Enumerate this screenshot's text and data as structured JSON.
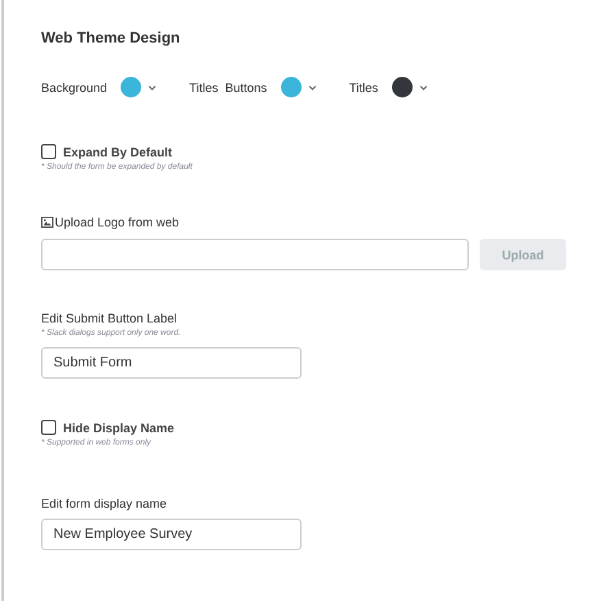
{
  "title": "Web Theme Design",
  "colors": [
    {
      "label": "Background",
      "color": "#3bb5d9"
    },
    {
      "label": "Titles  Buttons",
      "color": "#3bb5d9"
    },
    {
      "label": "Titles",
      "color": "#33363a"
    }
  ],
  "expand": {
    "label": "Expand By Default",
    "checked": false,
    "hint": "* Should the form be expanded by default"
  },
  "upload": {
    "label": "Upload Logo from web",
    "button": "Upload"
  },
  "submit_label": {
    "label": "Edit Submit Button Label",
    "hint": "* Slack dialogs support only one word.",
    "value": "Submit Form"
  },
  "hide_name": {
    "label": "Hide Display Name",
    "checked": false,
    "hint": "* Supported in web forms only"
  },
  "display_name": {
    "label": "Edit form display name",
    "value": "New Employee Survey"
  }
}
